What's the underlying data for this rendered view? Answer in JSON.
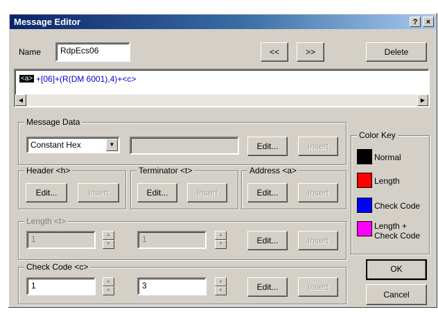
{
  "window": {
    "title": "Message Editor",
    "help_label": "?",
    "close_label": "×"
  },
  "name": {
    "label": "Name",
    "value": "RdpEcs06"
  },
  "nav": {
    "prev_label": "<<",
    "next_label": ">>",
    "delete_label": "Delete"
  },
  "message": {
    "token": "<a>",
    "text": "+[06]+(R(DM 6001),4)+<c>",
    "scroll_left": "◀",
    "scroll_right": "▶"
  },
  "message_data": {
    "title": "Message Data",
    "type_value": "Constant Hex",
    "value": "",
    "edit_label": "Edit...",
    "insert_label": "Insert"
  },
  "header": {
    "title": "Header <h>",
    "edit_label": "Edit...",
    "insert_label": "Insert"
  },
  "terminator": {
    "title": "Terminator <t>",
    "edit_label": "Edit...",
    "insert_label": "Insert"
  },
  "address": {
    "title": "Address <a>",
    "edit_label": "Edit...",
    "insert_label": "Insert"
  },
  "length": {
    "title": "Length <l>",
    "value1": "1",
    "value2": "1",
    "edit_label": "Edit...",
    "insert_label": "Insert"
  },
  "check_code": {
    "title": "Check Code <c>",
    "value1": "1",
    "value2": "3",
    "edit_label": "Edit...",
    "insert_label": "Insert"
  },
  "color_key": {
    "title": "Color Key",
    "items": [
      {
        "label": "Normal",
        "color": "#000000"
      },
      {
        "label": "Length",
        "color": "#ff0000"
      },
      {
        "label": "Check Code",
        "color": "#0000ff"
      },
      {
        "label": "Length +",
        "label2": "Check Code",
        "color": "#ff00ff"
      }
    ]
  },
  "footer": {
    "ok_label": "OK",
    "cancel_label": "Cancel"
  }
}
